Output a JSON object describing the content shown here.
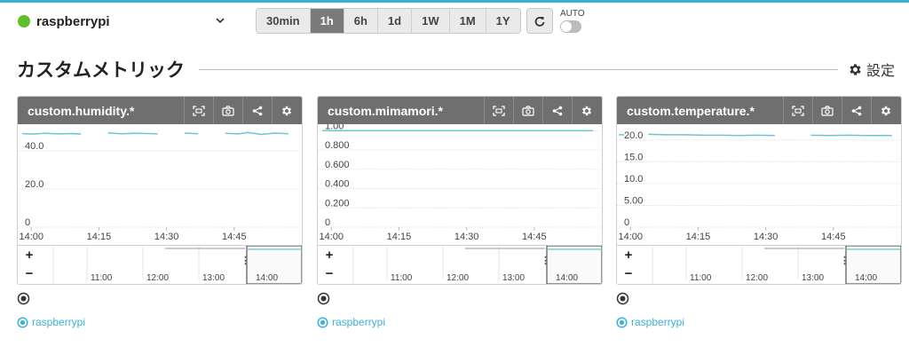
{
  "header": {
    "host_name": "raspberrypi",
    "host_status_color": "#5cc02a",
    "time_ranges": [
      "30min",
      "1h",
      "6h",
      "1d",
      "1W",
      "1M",
      "1Y"
    ],
    "active_range": "1h",
    "auto_label": "AUTO",
    "auto_enabled": false
  },
  "section": {
    "title": "カスタムメトリック",
    "settings_label": "設定"
  },
  "colors": {
    "accent": "#3ab2d6",
    "header_bg": "#6f6f6f",
    "series_line": "#6cc4d8"
  },
  "icons": {
    "host_status": "status-dot-icon",
    "dropdown": "chevron-down-icon",
    "refresh": "refresh-icon",
    "settings": "gear-icon",
    "fullscreen": "fullscreen-icon",
    "snapshot": "camera-icon",
    "share": "share-icon",
    "graph_settings": "gear-icon",
    "legend_toggle": "radio-icon"
  },
  "panels": [
    {
      "title": "custom.humidity.*",
      "legend_label": "raspberrypi",
      "chart_data": {
        "type": "line",
        "x": [
          "13:58",
          "14:00",
          "14:03",
          "14:06",
          "14:09",
          "14:11",
          "14:14",
          "14:17",
          "14:20",
          "14:23",
          "14:26",
          "14:28",
          "14:31",
          "14:34",
          "14:37",
          "14:40",
          "14:43",
          "14:46",
          "14:48",
          "14:51",
          "14:54",
          "14:57"
        ],
        "series": [
          {
            "name": "raspberrypi",
            "values": [
              49.0,
              48.7,
              49.1,
              48.8,
              49.0,
              48.7,
              null,
              49.3,
              48.9,
              49.1,
              49.0,
              48.8,
              null,
              49.2,
              48.9,
              null,
              49.1,
              48.8,
              49.5,
              48.5,
              49.2,
              48.9
            ]
          }
        ],
        "y_ticks": [
          "0",
          "20.0",
          "40.0"
        ],
        "x_ticks": [
          "14:00",
          "14:15",
          "14:30",
          "14:45"
        ],
        "ylim": [
          0,
          52
        ],
        "xlim": [
          "13:57",
          "15:00"
        ],
        "grid": true,
        "overview_ticks": [
          "11:00",
          "12:00",
          "13:00",
          "14:00"
        ]
      }
    },
    {
      "title": "custom.mimamori.*",
      "legend_label": "raspberrypi",
      "chart_data": {
        "type": "line",
        "x": [
          "13:58",
          "14:10",
          "14:20",
          "14:30",
          "14:40",
          "14:50",
          "14:58"
        ],
        "series": [
          {
            "name": "raspberrypi",
            "values": [
              1.0,
              1.0,
              1.0,
              1.0,
              1.0,
              1.0,
              1.0
            ]
          }
        ],
        "y_ticks": [
          "0",
          "0.200",
          "0.400",
          "0.600",
          "0.800",
          "1.00"
        ],
        "x_ticks": [
          "14:00",
          "14:15",
          "14:30",
          "14:45"
        ],
        "ylim": [
          0,
          1.03
        ],
        "xlim": [
          "13:57",
          "15:00"
        ],
        "grid": true,
        "overview_ticks": [
          "11:00",
          "12:00",
          "13:00",
          "14:00"
        ]
      }
    },
    {
      "title": "custom.temperature.*",
      "legend_label": "raspberrypi",
      "chart_data": {
        "type": "line",
        "x": [
          "13:58",
          "14:01",
          "14:04",
          "14:08",
          "14:12",
          "14:16",
          "14:20",
          "14:24",
          "14:28",
          "14:32",
          "14:36",
          "14:40",
          "14:44",
          "14:48",
          "14:52",
          "14:56",
          "14:58"
        ],
        "series": [
          {
            "name": "raspberrypi",
            "values": [
              21.2,
              null,
              21.3,
              21.2,
              21.2,
              21.1,
              21.1,
              21.0,
              21.1,
              21.0,
              null,
              21.1,
              21.0,
              21.1,
              21.0,
              21.0,
              21.0
            ]
          }
        ],
        "y_ticks": [
          "0",
          "5.00",
          "10.0",
          "15.0",
          "20.0"
        ],
        "x_ticks": [
          "14:00",
          "14:15",
          "14:30",
          "14:45"
        ],
        "ylim": [
          0,
          22.8
        ],
        "xlim": [
          "13:57",
          "15:00"
        ],
        "grid": true,
        "overview_ticks": [
          "11:00",
          "12:00",
          "13:00",
          "14:00"
        ]
      }
    }
  ]
}
